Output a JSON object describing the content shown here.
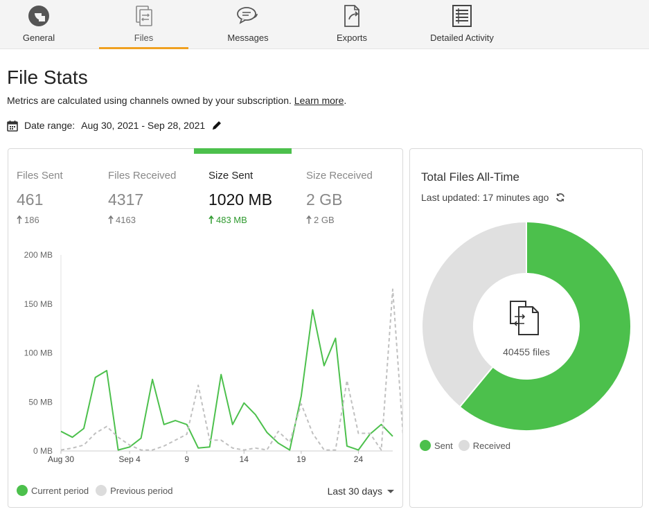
{
  "nav": {
    "tabs": [
      {
        "label": "General",
        "icon": "pie-chart-icon"
      },
      {
        "label": "Files",
        "icon": "files-icon",
        "active": true
      },
      {
        "label": "Messages",
        "icon": "chat-bubbles-icon"
      },
      {
        "label": "Exports",
        "icon": "export-file-icon"
      },
      {
        "label": "Detailed Activity",
        "icon": "activity-list-icon"
      }
    ]
  },
  "page": {
    "title": "File Stats",
    "subtitle": "Metrics are calculated using channels owned by your subscription.",
    "learn_more": "Learn more",
    "period_dot": ".",
    "date_range_label": "Date range:",
    "date_range_value": "Aug 30, 2021 - Sep 28, 2021"
  },
  "metrics": [
    {
      "label": "Files Sent",
      "value": "461",
      "delta": "186"
    },
    {
      "label": "Files Received",
      "value": "4317",
      "delta": "4163"
    },
    {
      "label": "Size Sent",
      "value": "1020 MB",
      "delta": "483 MB",
      "active": true
    },
    {
      "label": "Size Received",
      "value": "2 GB",
      "delta": "2 GB"
    }
  ],
  "colors": {
    "accent_orange": "#f0a020",
    "green": "#4cc04c",
    "delta_green": "#2f9a2f",
    "gray_series": "#c0c0c0",
    "donut_gray": "#e0e0e0"
  },
  "chart_data": {
    "type": "line",
    "y_ticks": [
      "0 MB",
      "50 MB",
      "100 MB",
      "150 MB",
      "200 MB"
    ],
    "ylim": [
      0,
      200
    ],
    "y_unit": "MB",
    "x_tick_labels": [
      {
        "index": 0,
        "label": "Aug 30"
      },
      {
        "index": 6,
        "label": "Sep 4"
      },
      {
        "index": 11,
        "label": "9"
      },
      {
        "index": 16,
        "label": "14"
      },
      {
        "index": 21,
        "label": "19"
      },
      {
        "index": 26,
        "label": "24"
      }
    ],
    "series": [
      {
        "name": "Current period",
        "style": "solid",
        "values": [
          20,
          14,
          23,
          75,
          82,
          1,
          4,
          13,
          73,
          27,
          31,
          27,
          3,
          4,
          78,
          27,
          49,
          37,
          19,
          8,
          1,
          56,
          144,
          87,
          115,
          5,
          1,
          17,
          27,
          15
        ]
      },
      {
        "name": "Previous period",
        "style": "dashed",
        "values": [
          1,
          3,
          6,
          18,
          25,
          14,
          6,
          1,
          1,
          5,
          11,
          17,
          67,
          11,
          11,
          3,
          1,
          3,
          1,
          20,
          9,
          48,
          18,
          1,
          1,
          72,
          18,
          18,
          1,
          165,
          1
        ]
      }
    ],
    "grid": false
  },
  "legend": {
    "current": "Current period",
    "previous": "Previous period"
  },
  "period_select": {
    "value": "Last 30 days"
  },
  "total": {
    "title": "Total Files All-Time",
    "updated": "Last updated: 17 minutes ago",
    "count_text": "40455 files",
    "sent_label": "Sent",
    "received_label": "Received",
    "donut": {
      "sent_fraction": 0.61,
      "received_fraction": 0.39
    }
  }
}
